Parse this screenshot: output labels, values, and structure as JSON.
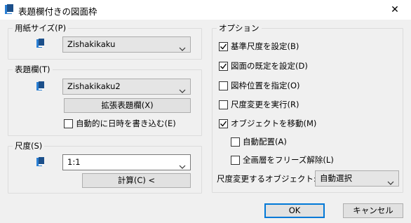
{
  "window": {
    "title": "表題欄付きの図面枠",
    "close_symbol": "✕",
    "icon": "app-icon"
  },
  "paper_size": {
    "label": "用紙サイズ(P)",
    "selected": "Zishakikaku"
  },
  "title_block": {
    "label": "表題欄(T)",
    "selected": "Zishakikaku2",
    "extend_button": "拡張表題欄(X)",
    "auto_datetime": {
      "label": "自動的に日時を書き込む(E)",
      "checked": false
    }
  },
  "scale": {
    "label": "尺度(S)",
    "value": "1:1",
    "calc_button": "計算(C) <"
  },
  "options": {
    "label": "オプション",
    "items": [
      {
        "label": "基準尺度を設定(B)",
        "checked": true
      },
      {
        "label": "図面の既定を設定(D)",
        "checked": true
      },
      {
        "label": "図枠位置を指定(O)",
        "checked": false
      },
      {
        "label": "尺度変更を実行(R)",
        "checked": false
      },
      {
        "label": "オブジェクトを移動(M)",
        "checked": true
      },
      {
        "label": "自動配置(A)",
        "checked": false
      },
      {
        "label": "全画層をフリーズ解除(L)",
        "checked": false
      }
    ],
    "scale_objects_label": "尺度変更するオブジェクト:",
    "scale_objects_selected": "自動選択"
  },
  "footer": {
    "ok": "OK",
    "cancel": "キャンセル"
  },
  "colors": {
    "icon_blue": "#2a7fd4",
    "icon_dark": "#1c4f8a",
    "accent": "#0078d7"
  }
}
